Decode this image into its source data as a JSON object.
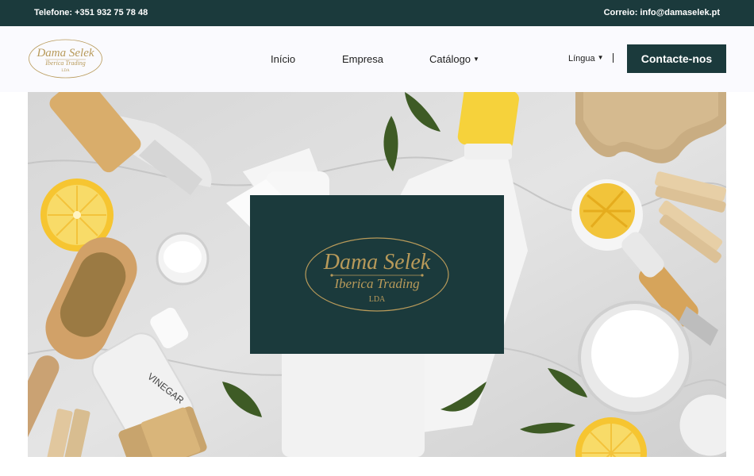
{
  "topbar": {
    "phone": "Telefone: +351 932 75 78 48",
    "email": "Correio: info@damaselek.pt"
  },
  "brand": {
    "name": "Dama Selek",
    "subtitle": "Iberica Trading",
    "suffix": "LDA",
    "gold": "#b89a5a"
  },
  "nav": {
    "items": [
      {
        "label": "Início"
      },
      {
        "label": "Empresa"
      },
      {
        "label": "Catálogo"
      }
    ],
    "language": "Língua",
    "cta": "Contacte-nos"
  },
  "colors": {
    "primary": "#1b3a3c",
    "header_bg": "#fafafe"
  },
  "hero": {
    "bottle_label": "VINEGAR"
  }
}
